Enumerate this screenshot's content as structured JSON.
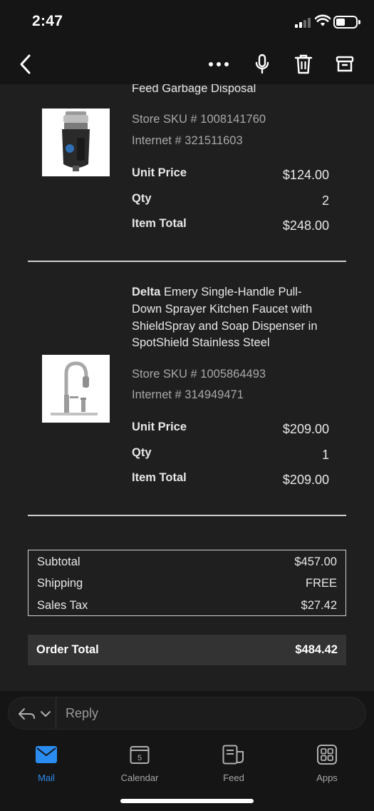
{
  "status_bar": {
    "time": "2:47"
  },
  "toolbar": {
    "back": "back-chevron-icon",
    "more": "more-dots-icon",
    "mic": "microphone-icon",
    "delete": "trash-icon",
    "archive": "archive-icon"
  },
  "items": [
    {
      "title_tail": "Feed Garbage Disposal",
      "store_sku": "Store SKU # 1008141760",
      "internet": "Internet # 321511603",
      "unit_price_label": "Unit Price",
      "unit_price": "$124.00",
      "qty_label": "Qty",
      "qty": "2",
      "item_total_label": "Item Total",
      "item_total": "$248.00"
    },
    {
      "brand": "Delta",
      "title_lines": [
        "Emery Single-Handle Pull-",
        "Down Sprayer Kitchen Faucet with",
        "ShieldSpray and Soap Dispenser in",
        "SpotShield Stainless Steel"
      ],
      "store_sku": "Store SKU # 1005864493",
      "internet": "Internet # 314949471",
      "unit_price_label": "Unit Price",
      "unit_price": "$209.00",
      "qty_label": "Qty",
      "qty": "1",
      "item_total_label": "Item Total",
      "item_total": "$209.00"
    }
  ],
  "summary": {
    "subtotal_label": "Subtotal",
    "subtotal": "$457.00",
    "shipping_label": "Shipping",
    "shipping": "FREE",
    "tax_label": "Sales Tax",
    "tax": "$27.42",
    "order_total_label": "Order Total",
    "order_total": "$484.42"
  },
  "reply": {
    "label": "Reply"
  },
  "tabs": [
    {
      "label": "Mail",
      "icon": "mail-icon"
    },
    {
      "label": "Calendar",
      "icon": "calendar-icon",
      "day": "5"
    },
    {
      "label": "Feed",
      "icon": "feed-icon"
    },
    {
      "label": "Apps",
      "icon": "apps-icon"
    }
  ],
  "colors": {
    "accent": "#2a8cf0",
    "background": "#1f1f1f"
  }
}
